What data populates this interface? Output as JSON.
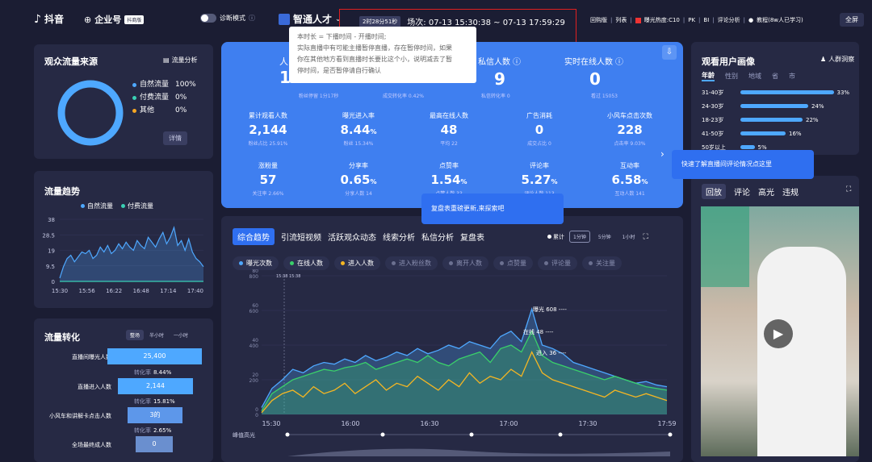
{
  "topbar": {
    "logo": "抖音",
    "enterprise": "企业号",
    "badge": "抖商版",
    "diagnose": "诊断模式",
    "anchor": "智通人才",
    "duration": "2时28分51秒",
    "session": "场次: 07-13 15:30:38 ~ 07-13 17:59:29",
    "links": [
      "回购版",
      "列表"
    ],
    "heat": "曝光热度:C10",
    "pk": "PK",
    "bi": "BI",
    "comment_analysis": "评论分析",
    "tutorial": "教程(8w人已学习)",
    "fullscreen": "全屏"
  },
  "tooltip": {
    "lines": [
      "本时长 = 下播时间 - 开播时间;",
      "实际直播中有可能主播暂停直播，存在暂停时间，如果",
      "你在其他地方看到直播时长要比这个小，说明减去了暂",
      "停时间，是否暂停请自行确认"
    ]
  },
  "traffic_source": {
    "title": "观众流量来源",
    "link": "流量分析",
    "items": [
      {
        "label": "自然流量",
        "value": "100%",
        "color": "#4ea8ff"
      },
      {
        "label": "付费流量",
        "value": "0%",
        "color": "#3ad0b4"
      },
      {
        "label": "其他",
        "value": "0%",
        "color": "#f5a623"
      }
    ],
    "detail": "详情"
  },
  "trend": {
    "title": "流量趋势",
    "legend": [
      {
        "label": "自然流量",
        "color": "#4ea8ff"
      },
      {
        "label": "付费流量",
        "color": "#3ad0b4"
      }
    ]
  },
  "conversion": {
    "title": "流量转化",
    "tabs": [
      "整场",
      "半小时",
      "一小时"
    ],
    "rows": [
      {
        "label": "直播间曝光人数",
        "value": "25,400"
      },
      {
        "label": "直播进入人数",
        "value": "2,144"
      },
      {
        "label": "小风车和讲解卡点击人数",
        "value": "3的"
      },
      {
        "label": "全场最终成人数",
        "value": "0"
      }
    ],
    "rates": [
      {
        "label": "转化率",
        "value": "8.44%"
      },
      {
        "label": "转化率",
        "value": "15.81%"
      },
      {
        "label": "转化率",
        "value": "2.65%"
      }
    ]
  },
  "stats": {
    "top": [
      {
        "label": "人",
        "value": "1",
        "sub": "粉丝停留 1分17秒"
      },
      {
        "label": "",
        "value": "",
        "sub": "成交转化率 0.42%"
      },
      {
        "label": "私信人数",
        "value": "9",
        "sub": "私信转化率 0"
      },
      {
        "label": "实时在线人数",
        "value": "0",
        "sub": "看过 15053"
      }
    ],
    "row1": [
      {
        "label": "累计观看人数",
        "value": "2,144",
        "unit": "",
        "sub": "粉丝占比 25.91%"
      },
      {
        "label": "曝光进入率",
        "value": "8.44",
        "unit": "%",
        "sub": "粉丝 15.34%"
      },
      {
        "label": "最高在线人数",
        "value": "48",
        "unit": "",
        "sub": "平均 22"
      },
      {
        "label": "广告消耗",
        "value": "0",
        "unit": "",
        "sub": "成交占比 0"
      },
      {
        "label": "小风车点击次数",
        "value": "228",
        "unit": "",
        "sub": "点击率 9.03%"
      }
    ],
    "row2": [
      {
        "label": "涨粉量",
        "value": "57",
        "unit": "",
        "sub": "关注率 2.66%"
      },
      {
        "label": "分享率",
        "value": "0.65",
        "unit": "%",
        "sub": "分享人数 14"
      },
      {
        "label": "点赞率",
        "value": "1.54",
        "unit": "%",
        "sub": "点赞人数 33"
      },
      {
        "label": "评论率",
        "value": "5.27",
        "unit": "%",
        "sub": "评论人数 113"
      },
      {
        "label": "互动率",
        "value": "6.58",
        "unit": "%",
        "sub": "互动人数 141"
      }
    ]
  },
  "tip_review": "复盘表重磅更新,来探索吧",
  "tip_comment": "快速了解直播间评论情况点这里",
  "main": {
    "tabs": [
      "综合趋势",
      "引流短视频",
      "活跃观众动态",
      "线索分析",
      "私信分析",
      "复盘表"
    ],
    "cumulative": "累计",
    "intervals": [
      "1分钟",
      "5分钟",
      "1小时"
    ],
    "chips": [
      {
        "label": "曝光次数",
        "color": "#4ea8ff",
        "on": true
      },
      {
        "label": "在线人数",
        "color": "#3ad06a",
        "on": true
      },
      {
        "label": "进入人数",
        "color": "#f5b623",
        "on": true
      },
      {
        "label": "进入粉丝数",
        "color": "#6b7090",
        "on": false
      },
      {
        "label": "离开人数",
        "color": "#6b7090",
        "on": false
      },
      {
        "label": "点赞量",
        "color": "#6b7090",
        "on": false
      },
      {
        "label": "评论量",
        "color": "#6b7090",
        "on": false
      },
      {
        "label": "关注量",
        "color": "#6b7090",
        "on": false
      }
    ],
    "slider_label": "峰值高光",
    "marker": "15:38 15:38"
  },
  "portrait": {
    "title": "观看用户画像",
    "link": "人群洞察",
    "tabs": [
      "年龄",
      "性别",
      "地域",
      "省",
      "市"
    ],
    "bars": [
      {
        "label": "31-40岁",
        "value": 33
      },
      {
        "label": "24-30岁",
        "value": 24
      },
      {
        "label": "18-23岁",
        "value": 22
      },
      {
        "label": "41-50岁",
        "value": 16
      },
      {
        "label": "50岁以上",
        "value": 5
      }
    ]
  },
  "replay": {
    "tabs": [
      "回放",
      "评论",
      "高光",
      "违规"
    ]
  },
  "chart_data": [
    {
      "type": "line",
      "chart": "流量趋势",
      "x": [
        "15:30",
        "15:56",
        "16:22",
        "16:48",
        "17:14",
        "17:40"
      ],
      "ylim": [
        0,
        38
      ],
      "yticks": [
        0,
        9.5,
        19,
        28.5,
        38
      ],
      "series": [
        {
          "name": "自然流量",
          "values": [
            2,
            9,
            14,
            16,
            12,
            15,
            18,
            17,
            19,
            14,
            16,
            21,
            18,
            22,
            17,
            19,
            23,
            20,
            24,
            21,
            19,
            25,
            22,
            20,
            27,
            24,
            21,
            26,
            30,
            23,
            27,
            33,
            22,
            25,
            19,
            26,
            18,
            14,
            12,
            9
          ]
        },
        {
          "name": "付费流量",
          "values": [
            0,
            0,
            0,
            0,
            0,
            0,
            0,
            0,
            0,
            0,
            0,
            0,
            0,
            0,
            0,
            0,
            0,
            0,
            0,
            0,
            0,
            0,
            0,
            0,
            0,
            0,
            0,
            0,
            0,
            0,
            0,
            0,
            0,
            0,
            0,
            0,
            0,
            0,
            0,
            0
          ]
        }
      ]
    },
    {
      "type": "area",
      "chart": "综合趋势",
      "x": [
        "15:30",
        "16:00",
        "16:30",
        "17:00",
        "17:30",
        "17:59"
      ],
      "y_left_ticks": [
        0,
        200,
        400,
        600,
        800
      ],
      "y_right_ticks": [
        0,
        20,
        40,
        60,
        80
      ],
      "annotations": [
        "曝光 608",
        "在线 48",
        "进入 36"
      ],
      "series": [
        {
          "name": "曝光次数",
          "values": [
            40,
            150,
            200,
            260,
            240,
            280,
            300,
            290,
            320,
            300,
            340,
            310,
            330,
            360,
            340,
            380,
            350,
            370,
            400,
            380,
            420,
            400,
            380,
            450,
            480,
            420,
            608,
            400,
            380,
            350,
            300,
            280,
            260,
            240,
            220,
            200,
            180,
            190,
            170,
            160
          ]
        },
        {
          "name": "在线人数",
          "values": [
            2,
            12,
            16,
            20,
            22,
            24,
            26,
            25,
            27,
            28,
            30,
            26,
            28,
            30,
            32,
            30,
            34,
            30,
            28,
            32,
            34,
            36,
            30,
            38,
            40,
            36,
            48,
            34,
            30,
            28,
            26,
            24,
            22,
            20,
            22,
            20,
            18,
            16,
            15,
            14
          ]
        },
        {
          "name": "进入人数",
          "values": [
            1,
            8,
            12,
            14,
            10,
            16,
            12,
            14,
            18,
            12,
            16,
            20,
            14,
            18,
            16,
            22,
            18,
            14,
            20,
            16,
            24,
            18,
            22,
            20,
            26,
            22,
            36,
            24,
            20,
            18,
            16,
            14,
            12,
            10,
            14,
            12,
            10,
            12,
            10,
            8
          ]
        }
      ]
    }
  ]
}
